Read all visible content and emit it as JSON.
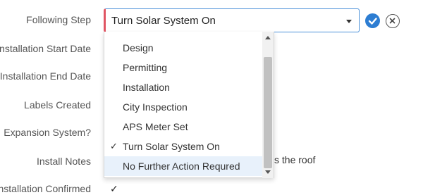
{
  "form": {
    "labels": {
      "following_step": "Following Step",
      "installation_start_date": "Installation Start Date",
      "installation_end_date": "Installation End Date",
      "labels_created": "Labels Created",
      "expansion_system": "Expansion System?",
      "install_notes": "Install Notes",
      "installation_confirmed": "Installation Confirmed"
    },
    "install_notes_visible_text": "s the roof",
    "installation_confirmed_check": "✓"
  },
  "select": {
    "value": "Turn Solar System On",
    "options": [
      {
        "label": "Design"
      },
      {
        "label": "Permitting"
      },
      {
        "label": "Installation"
      },
      {
        "label": "City Inspection"
      },
      {
        "label": "APS Meter Set"
      },
      {
        "label": "Turn Solar System On",
        "selected": true
      },
      {
        "label": "No Further Action Requred",
        "hovered": true
      }
    ],
    "check_glyph": "✓"
  },
  "colors": {
    "accent_blue": "#2d7dd2",
    "required_red": "#e05563",
    "hover_bg": "#e8f1fb"
  },
  "icons": {
    "confirm": "check-circle-icon",
    "cancel": "close-circle-icon",
    "dropdown": "chevron-down-icon"
  }
}
